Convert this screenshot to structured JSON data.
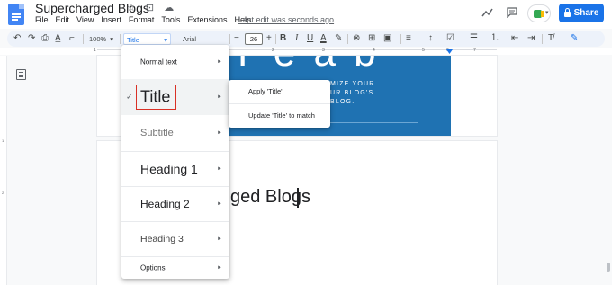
{
  "app": {
    "doc_title": "Supercharged Blogs",
    "title_icons": "☆ ⊡ ☁",
    "menu": [
      "File",
      "Edit",
      "View",
      "Insert",
      "Format",
      "Tools",
      "Extensions",
      "Help"
    ],
    "last_edit": "Last edit was seconds ago",
    "share_label": "Share",
    "icons": {
      "activity": "trend-icon",
      "comments": "comment-icon",
      "meet": "meet-icon"
    }
  },
  "toolbar": {
    "zoom": "100%",
    "style": "Title",
    "font": "Arial",
    "font_size": "26",
    "minus": "−",
    "plus": "+",
    "undo": "↶",
    "redo": "↷",
    "print": "⎙",
    "spell": "A̲",
    "paint": "⌐",
    "bold": "B",
    "italic": "I",
    "underline": "U",
    "text_color": "A",
    "highlight": "✎",
    "link": "⊗",
    "comment": "⊞",
    "image": "▣",
    "align": "≡",
    "line_spacing": "↕",
    "checklist": "☑",
    "bullets": "☰",
    "numbered": "⒈",
    "outdent": "⇤",
    "indent": "⇥",
    "clear": "T̸",
    "edit_mode": "✎"
  },
  "ruler": {
    "numbers": [
      "1",
      "1",
      "2",
      "3",
      "4",
      "5",
      "6",
      "7"
    ]
  },
  "vruler": {
    "numbers": [
      "1",
      "2"
    ]
  },
  "document": {
    "banner_big": "Y e a b",
    "banner_lines": [
      "MIZE YOUR",
      "UR BLOG'S",
      "BLOG."
    ],
    "body_text": "ged Blogs"
  },
  "style_menu": {
    "items": [
      {
        "label": "Normal text",
        "arrow": "►"
      },
      {
        "label": "Title",
        "arrow": "►",
        "checked": true
      },
      {
        "label": "Subtitle",
        "arrow": "►"
      },
      {
        "label": "Heading 1",
        "arrow": "►"
      },
      {
        "label": "Heading 2",
        "arrow": "►"
      },
      {
        "label": "Heading 3",
        "arrow": "►"
      },
      {
        "label": "Options",
        "arrow": "►"
      }
    ],
    "check": "✓"
  },
  "submenu": {
    "apply": "Apply 'Title'",
    "update": "Update 'Title' to match"
  },
  "colors": {
    "accent": "#1a73e8",
    "banner": "#1f72b2",
    "highlight_box": "#d93025"
  }
}
